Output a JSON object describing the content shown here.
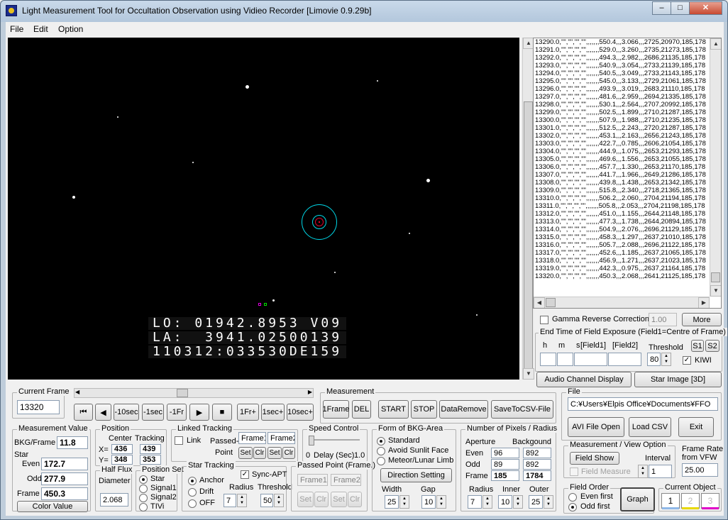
{
  "window": {
    "title": "Light Measurement Tool for Occultation Observation using Vidieo Recorder [Limovie 0.9.29b]",
    "minimize": "–",
    "maximize": "□",
    "close": "✕"
  },
  "menu": [
    "File",
    "Edit",
    "Option"
  ],
  "video": {
    "osd_line1": "LO: 01942.8953 V09",
    "osd_line2": "LA:  3941.02500139",
    "osd_line3": "110312:033530DE159"
  },
  "log_rows": [
    "13290.0,\"\",\"\",\"\",\"\",,,,,,,550.4,,,3.066,,,2725,20970,185,178",
    "13291.0,\"\",\"\",\"\",\"\",,,,,,,529.0,,,3.260,,,2735,21273,185,178",
    "13292.0,\"\",\"\",\"\",\"\",,,,,,,494.3,,,2.982,,,2686,21135,185,178",
    "13293.0,\"\",\"\",\"\",\"\",,,,,,,540.9,,,3.054,,,2733,21139,185,178",
    "13294.0,\"\",\"\",\"\",\"\",,,,,,,540.5,,,3.049,,,2733,21143,185,178",
    "13295.0,\"\",\"\",\"\",\"\",,,,,,,545.0,,,3.133,,,2729,21061,185,178",
    "13296.0,\"\",\"\",\"\",\"\",,,,,,,493.9,,,3.019,,,2683,21110,185,178",
    "13297.0,\"\",\"\",\"\",\"\",,,,,,,481.6,,,2.959,,,2694,21335,185,178",
    "13298.0,\"\",\"\",\"\",\"\",,,,,,,530.1,,,2.564,,,2707,20992,185,178",
    "13299.0,\"\",\"\",\"\",\"\",,,,,,,502.5,,,1.899,,,2710,21287,185,178",
    "13300.0,\"\",\"\",\"\",\"\",,,,,,,507.9,,,1.988,,,2710,21235,185,178",
    "13301.0,\"\",\"\",\"\",\"\",,,,,,,512.5,,,2.243,,,2720,21287,185,178",
    "13302.0,\"\",\"\",\"\",\"\",,,,,,,453.1,,,2.163,,,2656,21243,185,178",
    "13303.0,\"\",\"\",\"\",\"\",,,,,,,422.7,,,0.785,,,2606,21054,185,178",
    "13304.0,\"\",\"\",\"\",\"\",,,,,,,444.9,,,1.075,,,2653,21293,185,178",
    "13305.0,\"\",\"\",\"\",\"\",,,,,,,469.6,,,1.556,,,2653,21055,185,178",
    "13306.0,\"\",\"\",\"\",\"\",,,,,,,457.7,,,1.330,,,2653,21170,185,178",
    "13307.0,\"\",\"\",\"\",\"\",,,,,,,441.7,,,1.966,,,2649,21286,185,178",
    "13308.0,\"\",\"\",\"\",\"\",,,,,,,439.8,,,1.438,,,2653,21342,185,178",
    "13309.0,\"\",\"\",\"\",\"\",,,,,,,515.8,,,2.340,,,2718,21365,185,178",
    "13310.0,\"\",\"\",\"\",\"\",,,,,,,506.2,,,2.060,,,2704,21194,185,178",
    "13311.0,\"\",\"\",\"\",\"\",,,,,,,505.8,,,2.053,,,2704,21198,185,178",
    "13312.0,\"\",\"\",\"\",\"\",,,,,,,451.0,,,1.155,,,2644,21148,185,178",
    "13313.0,\"\",\"\",\"\",\"\",,,,,,,477.3,,,1.738,,,2644,20894,185,178",
    "13314.0,\"\",\"\",\"\",\"\",,,,,,,504.9,,,2.076,,,2696,21129,185,178",
    "13315.0,\"\",\"\",\"\",\"\",,,,,,,458.3,,,1.297,,,2637,21010,185,178",
    "13316.0,\"\",\"\",\"\",\"\",,,,,,,505.7,,,2.088,,,2696,21122,185,178",
    "13317.0,\"\",\"\",\"\",\"\",,,,,,,452.6,,,1.185,,,2637,21065,185,178",
    "13318.0,\"\",\"\",\"\",\"\",,,,,,,456.9,,,1.271,,,2637,21023,185,178",
    "13319.0,\"\",\"\",\"\",\"\",,,,,,,442.3,,,0.975,,,2637,21164,185,178",
    "13320.0,\"\",\"\",\"\",\"\",,,,,,,450.3,,,2.068,,,2641,21125,185,178"
  ],
  "gamma": {
    "label": "Gamma Reverse Correction",
    "value": "1.00",
    "more": "More"
  },
  "end_time": {
    "title": "End Time of Field Exposure (Field1=Centre of Frame)",
    "h": "h",
    "m": "m",
    "s": "s",
    "field1": "[Field1]",
    "field2": "[Field2]",
    "threshold_label": "Threshold",
    "threshold": "80",
    "s1": "S1",
    "s2": "S2",
    "kiwi": "KIWI"
  },
  "audio_button": "Audio Channel Display",
  "star_image_button": "Star Image [3D]",
  "current_frame": {
    "title": "Current Frame",
    "value": "13320"
  },
  "transport": [
    "⏮",
    "◀",
    "-10sec",
    "-1sec",
    "-1Fr",
    "▶",
    "■",
    "1Fr+",
    "1sec+",
    "10sec+"
  ],
  "measurement": {
    "title": "Measurement",
    "buttons": [
      "1Frame",
      "DEL",
      "START",
      "STOP",
      "DataRemove",
      "SaveToCSV-File"
    ]
  },
  "file": {
    "title": "File",
    "path": "C:¥Users¥Elpis Office¥Documents¥FFO",
    "avi_open": "AVI File Open",
    "load_csv": "Load CSV",
    "exit": "Exit"
  },
  "meas_value": {
    "title": "Measurement Value",
    "bkg_label": "BKG/Frame",
    "bkg": "11.8",
    "star_label": "Star",
    "even_label": "Even",
    "even": "172.7",
    "odd_label": "Odd",
    "odd": "277.9",
    "frame_label": "Frame",
    "frame": "450.3",
    "color_button": "Color Value"
  },
  "position": {
    "title": "Position",
    "center": "Center",
    "tracking": "Tracking",
    "x_label": "X=",
    "x_center": "436",
    "x_tracking": "439",
    "y_label": "Y=",
    "y_center": "348",
    "y_tracking": "353"
  },
  "half_flux": {
    "title": "Half Flux",
    "sub": "Diameter",
    "value": "2.068"
  },
  "position_set": {
    "title": "Position Set",
    "options": [
      "Star",
      "Signal1",
      "Signal2",
      "TIVi"
    ]
  },
  "linked_tracking": {
    "title": "Linked Tracking",
    "link": "Link",
    "passed": "Passed-",
    "point": "Point",
    "frame1": "Frame1",
    "frame2": "Frame2",
    "set": "Set",
    "clr": "Clr"
  },
  "speed": {
    "title": "Speed Control",
    "zero": "0",
    "delay": "Delay (Sec)",
    "max": "1.0"
  },
  "star_tracking": {
    "title": "Star Tracking",
    "options": [
      "Anchor",
      "Drift",
      "OFF"
    ],
    "sync": "Sync-APT",
    "radius_label": "Radius",
    "radius": "7",
    "threshold_label": "Threshold",
    "threshold": "50"
  },
  "passed_point": {
    "title": "Passed Point (Frame.)",
    "frame1": "Frame1",
    "frame2": "Frame2",
    "set": "Set",
    "clr": "Clr"
  },
  "bkg_area": {
    "title": "Form of BKG-Area",
    "options": [
      "Standard",
      "Avoid Sunlit Face",
      "Meteor/Lunar Limb"
    ],
    "direction": "Direction Setting",
    "width_label": "Width",
    "width": "25",
    "gap_label": "Gap",
    "gap": "10"
  },
  "pixels": {
    "title": "Number of Pixels / Radius",
    "aperture": "Aperture",
    "background": "Backgound",
    "even_label": "Even",
    "even_ap": "96",
    "even_bg": "892",
    "odd_label": "Odd",
    "odd_ap": "89",
    "odd_bg": "892",
    "frame_label": "Frame",
    "frame_ap": "185",
    "frame_bg": "1784",
    "radius_label": "Radius",
    "radius": "7",
    "inner_label": "Inner",
    "inner": "10",
    "outer_label": "Outer",
    "outer": "25"
  },
  "view_option": {
    "title": "Measurement / View Option",
    "field_show": "Field Show",
    "interval_label": "Interval",
    "interval": "1",
    "field_measure": "Field Measure"
  },
  "frame_rate": {
    "title": "Frame Rate",
    "sub": "from VFW",
    "value": "25.00"
  },
  "field_order": {
    "title": "Field Order",
    "even": "Even first",
    "odd": "Odd first",
    "graph": "Graph"
  },
  "current_object": {
    "title": "Current Object",
    "items": [
      "1",
      "2",
      "3"
    ],
    "colors": [
      "#8fb8e8",
      "#e8d800",
      "#e000c8"
    ]
  },
  "colors": {
    "video_bg": "#000000",
    "aperture_ring": "#00d8e8",
    "star_marker": "#e0002a"
  }
}
